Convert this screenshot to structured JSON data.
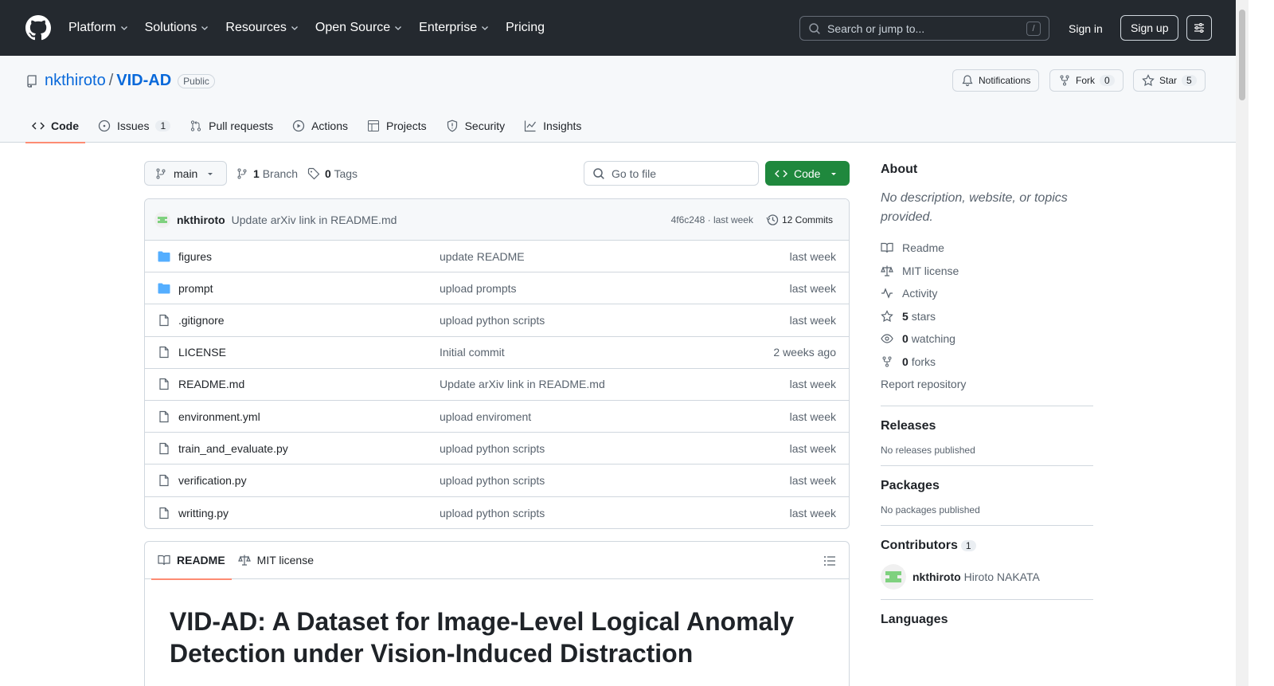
{
  "header": {
    "nav": [
      "Platform",
      "Solutions",
      "Resources",
      "Open Source",
      "Enterprise",
      "Pricing"
    ],
    "search_placeholder": "Search or jump to...",
    "search_kbd": "/",
    "signin": "Sign in",
    "signup": "Sign up"
  },
  "repo": {
    "owner": "nkthiroto",
    "slash": "/",
    "name": "VID-AD",
    "visibility": "Public",
    "notifications": "Notifications",
    "fork_label": "Fork",
    "fork_count": "0",
    "star_label": "Star",
    "star_count": "5"
  },
  "tabs": {
    "code": "Code",
    "issues": "Issues",
    "issues_count": "1",
    "pulls": "Pull requests",
    "actions": "Actions",
    "projects": "Projects",
    "security": "Security",
    "insights": "Insights"
  },
  "toolbar": {
    "branch": "main",
    "branch_count": "1",
    "branch_word": "Branch",
    "tag_count": "0",
    "tag_word": "Tags",
    "goto_file": "Go to file",
    "code_button": "Code"
  },
  "commit": {
    "author": "nkthiroto",
    "message": "Update arXiv link in README.md",
    "meta": "4f6c248 · last week",
    "commits": "12 Commits"
  },
  "files": [
    {
      "type": "dir",
      "name": "figures",
      "msg": "update README",
      "date": "last week"
    },
    {
      "type": "dir",
      "name": "prompt",
      "msg": "upload prompts",
      "date": "last week"
    },
    {
      "type": "file",
      "name": ".gitignore",
      "msg": "upload python scripts",
      "date": "last week"
    },
    {
      "type": "file",
      "name": "LICENSE",
      "msg": "Initial commit",
      "date": "2 weeks ago"
    },
    {
      "type": "file",
      "name": "README.md",
      "msg": "Update arXiv link in README.md",
      "date": "last week"
    },
    {
      "type": "file",
      "name": "environment.yml",
      "msg": "upload enviroment",
      "date": "last week"
    },
    {
      "type": "file",
      "name": "train_and_evaluate.py",
      "msg": "upload python scripts",
      "date": "last week"
    },
    {
      "type": "file",
      "name": "verification.py",
      "msg": "upload python scripts",
      "date": "last week"
    },
    {
      "type": "file",
      "name": "writting.py",
      "msg": "upload python scripts",
      "date": "last week"
    }
  ],
  "readme": {
    "tab_readme": "README",
    "tab_license": "MIT license",
    "title": "VID-AD: A Dataset for Image-Level Logical Anomaly Detection under Vision-Induced Distraction"
  },
  "about": {
    "heading": "About",
    "description": "No description, website, or topics provided.",
    "readme": "Readme",
    "license": "MIT license",
    "activity": "Activity",
    "stars_count": "5",
    "stars_word": "stars",
    "watching_count": "0",
    "watching_word": "watching",
    "forks_count": "0",
    "forks_word": "forks",
    "report": "Report repository"
  },
  "releases": {
    "heading": "Releases",
    "text": "No releases published"
  },
  "packages": {
    "heading": "Packages",
    "text": "No packages published"
  },
  "contributors": {
    "heading": "Contributors",
    "count": "1",
    "login": "nkthiroto",
    "fullname": "Hiroto NAKATA"
  },
  "languages": {
    "heading": "Languages"
  },
  "colors": {
    "accent": "#0969da",
    "green": "#1f883d",
    "header_bg": "#24292f",
    "tab_underline": "#fd8c73",
    "folder": "#54aeff"
  }
}
